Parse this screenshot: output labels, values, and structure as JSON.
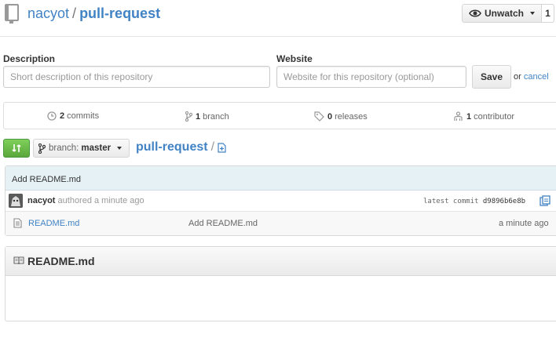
{
  "header": {
    "owner": "nacyot",
    "separator": "/",
    "repo": "pull-request",
    "watch_label": "Unwatch",
    "watch_count": "1"
  },
  "description_form": {
    "description_label": "Description",
    "description_placeholder": "Short description of this repository",
    "website_label": "Website",
    "website_placeholder": "Website for this repository (optional)",
    "save_label": "Save",
    "or_text": "or",
    "cancel_label": "cancel"
  },
  "stats": {
    "commits_count": "2",
    "commits_label": "commits",
    "branches_count": "1",
    "branches_label": "branch",
    "releases_count": "0",
    "releases_label": "releases",
    "contributors_count": "1",
    "contributors_label": "contributor"
  },
  "branch": {
    "prefix": "branch:",
    "name": "master",
    "breadcrumb_repo": "pull-request",
    "breadcrumb_sep": "/"
  },
  "commit": {
    "message": "Add README.md",
    "author": "nacyot",
    "authored_text": "authored a minute ago",
    "latest_label": "latest commit",
    "sha": "d9896b6e8b"
  },
  "files": [
    {
      "name": "README.md",
      "message": "Add README.md",
      "age": "a minute ago"
    }
  ],
  "readme": {
    "title": "README.md"
  },
  "colors": {
    "link": "#4183c4",
    "commit_bar": "#e6f1f6",
    "compare_green": "#6cc644"
  }
}
